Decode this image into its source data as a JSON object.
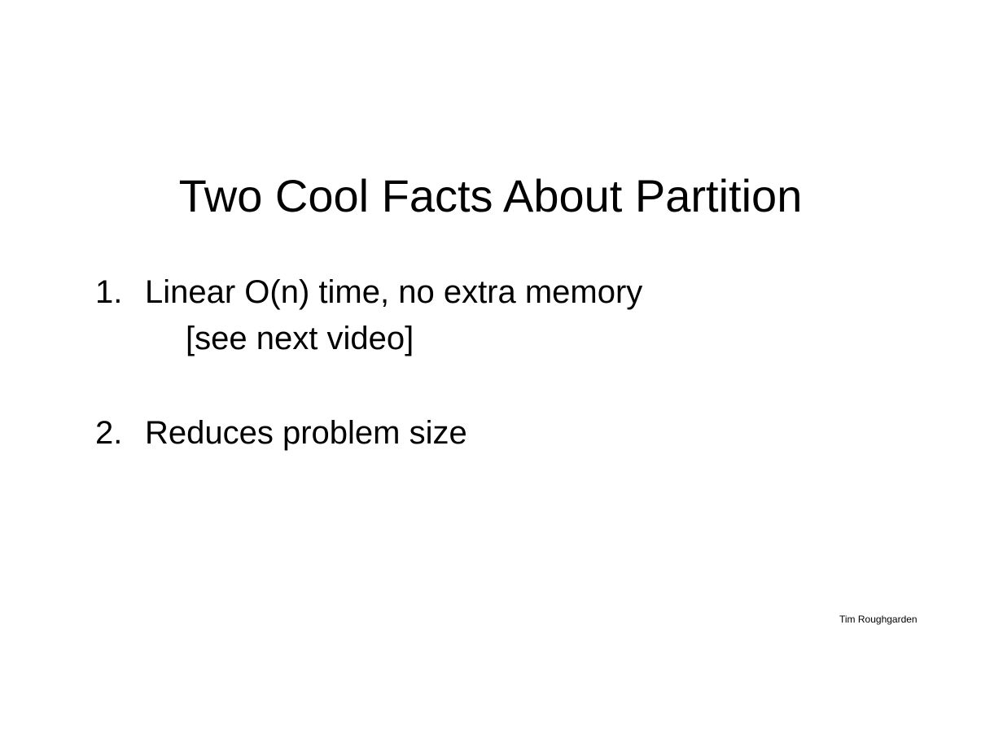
{
  "slide": {
    "title": "Two Cool Facts About Partition",
    "items": [
      {
        "number": "1.",
        "text": "Linear O(n) time, no extra memory",
        "subtext": "[see next video]"
      },
      {
        "number": "2.",
        "text": "Reduces problem size"
      }
    ],
    "footer": "Tim Roughgarden"
  }
}
